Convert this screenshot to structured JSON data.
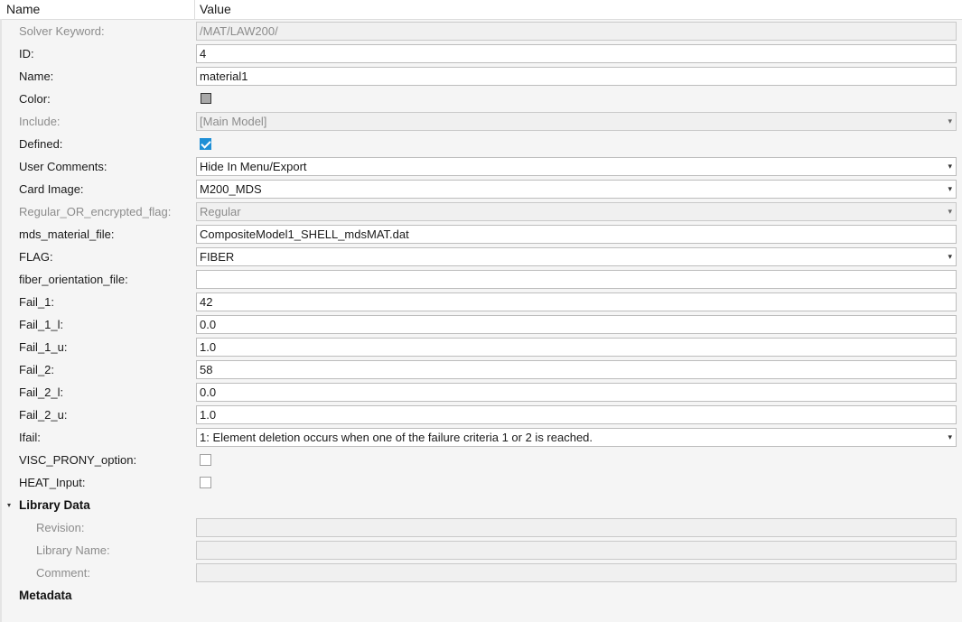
{
  "header": {
    "name_col": "Name",
    "value_col": "Value"
  },
  "rows": [
    {
      "label": "Solver Keyword:",
      "value": "/MAT/LAW200/"
    },
    {
      "label": "ID:",
      "value": "4"
    },
    {
      "label": "Name:",
      "value": "material1"
    },
    {
      "label": "Color:",
      "swatch": "#a8a8a8"
    },
    {
      "label": "Include:",
      "value": "[Main Model]"
    },
    {
      "label": "Defined:",
      "checked": true
    },
    {
      "label": "User Comments:",
      "value": "Hide In Menu/Export"
    },
    {
      "label": "Card Image:",
      "value": "M200_MDS"
    },
    {
      "label": "Regular_OR_encrypted_flag:",
      "value": "Regular"
    },
    {
      "label": "mds_material_file:",
      "value": "CompositeModel1_SHELL_mdsMAT.dat"
    },
    {
      "label": "FLAG:",
      "value": "FIBER"
    },
    {
      "label": "fiber_orientation_file:",
      "value": ""
    },
    {
      "label": "Fail_1:",
      "value": "42"
    },
    {
      "label": "Fail_1_l:",
      "value": "0.0"
    },
    {
      "label": "Fail_1_u:",
      "value": "1.0"
    },
    {
      "label": "Fail_2:",
      "value": "58"
    },
    {
      "label": "Fail_2_l:",
      "value": "0.0"
    },
    {
      "label": "Fail_2_u:",
      "value": "1.0"
    },
    {
      "label": "Ifail:",
      "value": "1: Element deletion occurs when one of the failure criteria 1 or 2 is reached."
    },
    {
      "label": "VISC_PRONY_option:",
      "checked": false
    },
    {
      "label": "HEAT_Input:",
      "checked": false
    }
  ],
  "library": {
    "label": "Library Data",
    "expand_glyph": "▾",
    "items": [
      {
        "label": "Revision:",
        "value": ""
      },
      {
        "label": "Library Name:",
        "value": ""
      },
      {
        "label": "Comment:",
        "value": ""
      }
    ]
  },
  "metadata": {
    "label": "Metadata"
  },
  "glyphs": {
    "dropdown_caret": "▾"
  },
  "colors": {
    "checkbox_accent": "#1e8fd6",
    "swatch": "#a8a8a8"
  }
}
